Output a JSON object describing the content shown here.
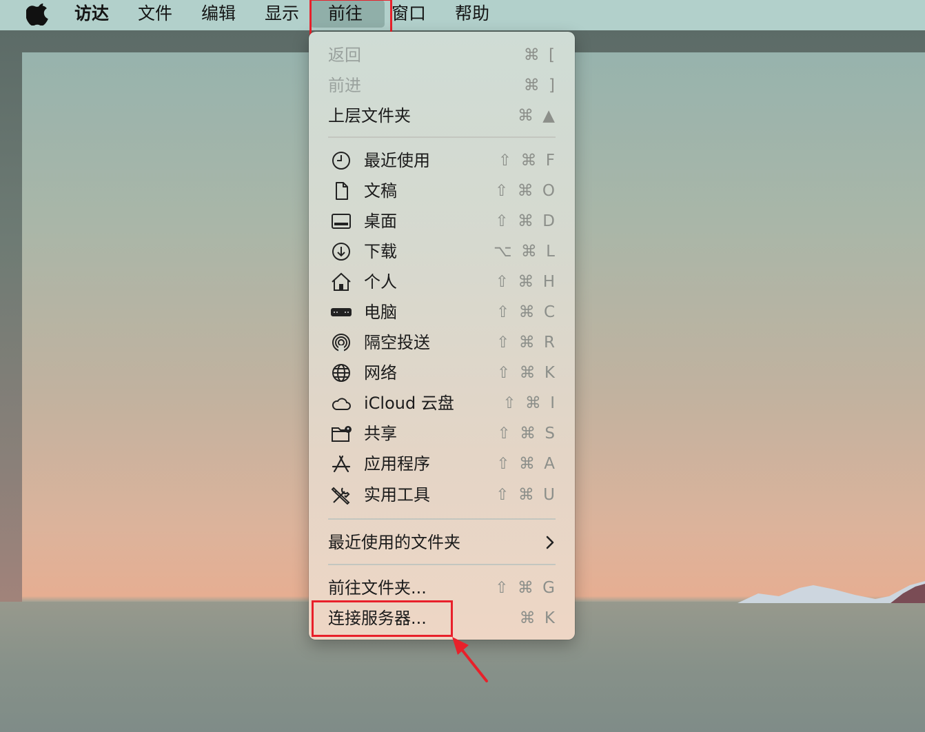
{
  "menubar": {
    "finder": "访达",
    "file": "文件",
    "edit": "编辑",
    "view": "显示",
    "go": "前往",
    "window": "窗口",
    "help": "帮助"
  },
  "go_menu": {
    "nav": [
      {
        "label": "返回",
        "shortcut": "⌘ [",
        "disabled": true
      },
      {
        "label": "前进",
        "shortcut": "⌘ ]",
        "disabled": true
      },
      {
        "label": "上层文件夹",
        "shortcut": "⌘ ▲",
        "disabled": false
      }
    ],
    "places": [
      {
        "label": "最近使用",
        "shortcut": "⇧ ⌘ F",
        "icon": "clock-icon"
      },
      {
        "label": "文稿",
        "shortcut": "⇧ ⌘ O",
        "icon": "document-icon"
      },
      {
        "label": "桌面",
        "shortcut": "⇧ ⌘ D",
        "icon": "desktop-icon"
      },
      {
        "label": "下载",
        "shortcut": "⌥ ⌘ L",
        "icon": "download-icon"
      },
      {
        "label": "个人",
        "shortcut": "⇧ ⌘ H",
        "icon": "home-icon"
      },
      {
        "label": "电脑",
        "shortcut": "⇧ ⌘ C",
        "icon": "computer-icon"
      },
      {
        "label": "隔空投送",
        "shortcut": "⇧ ⌘ R",
        "icon": "airdrop-icon"
      },
      {
        "label": "网络",
        "shortcut": "⇧ ⌘ K",
        "icon": "globe-icon"
      },
      {
        "label": "iCloud 云盘",
        "shortcut": "⇧ ⌘ I",
        "icon": "cloud-icon"
      },
      {
        "label": "共享",
        "shortcut": "⇧ ⌘ S",
        "icon": "shared-folder-icon"
      },
      {
        "label": "应用程序",
        "shortcut": "⇧ ⌘ A",
        "icon": "app-store-icon"
      },
      {
        "label": "实用工具",
        "shortcut": "⇧ ⌘ U",
        "icon": "tools-icon"
      }
    ],
    "recent_folders": {
      "label": "最近使用的文件夹",
      "icon": "chevron-right-icon"
    },
    "goto_folder": {
      "label": "前往文件夹...",
      "shortcut": "⇧ ⌘ G"
    },
    "connect_server": {
      "label": "连接服务器...",
      "shortcut": "⌘ K"
    }
  },
  "annotation_color": "#e8202a"
}
